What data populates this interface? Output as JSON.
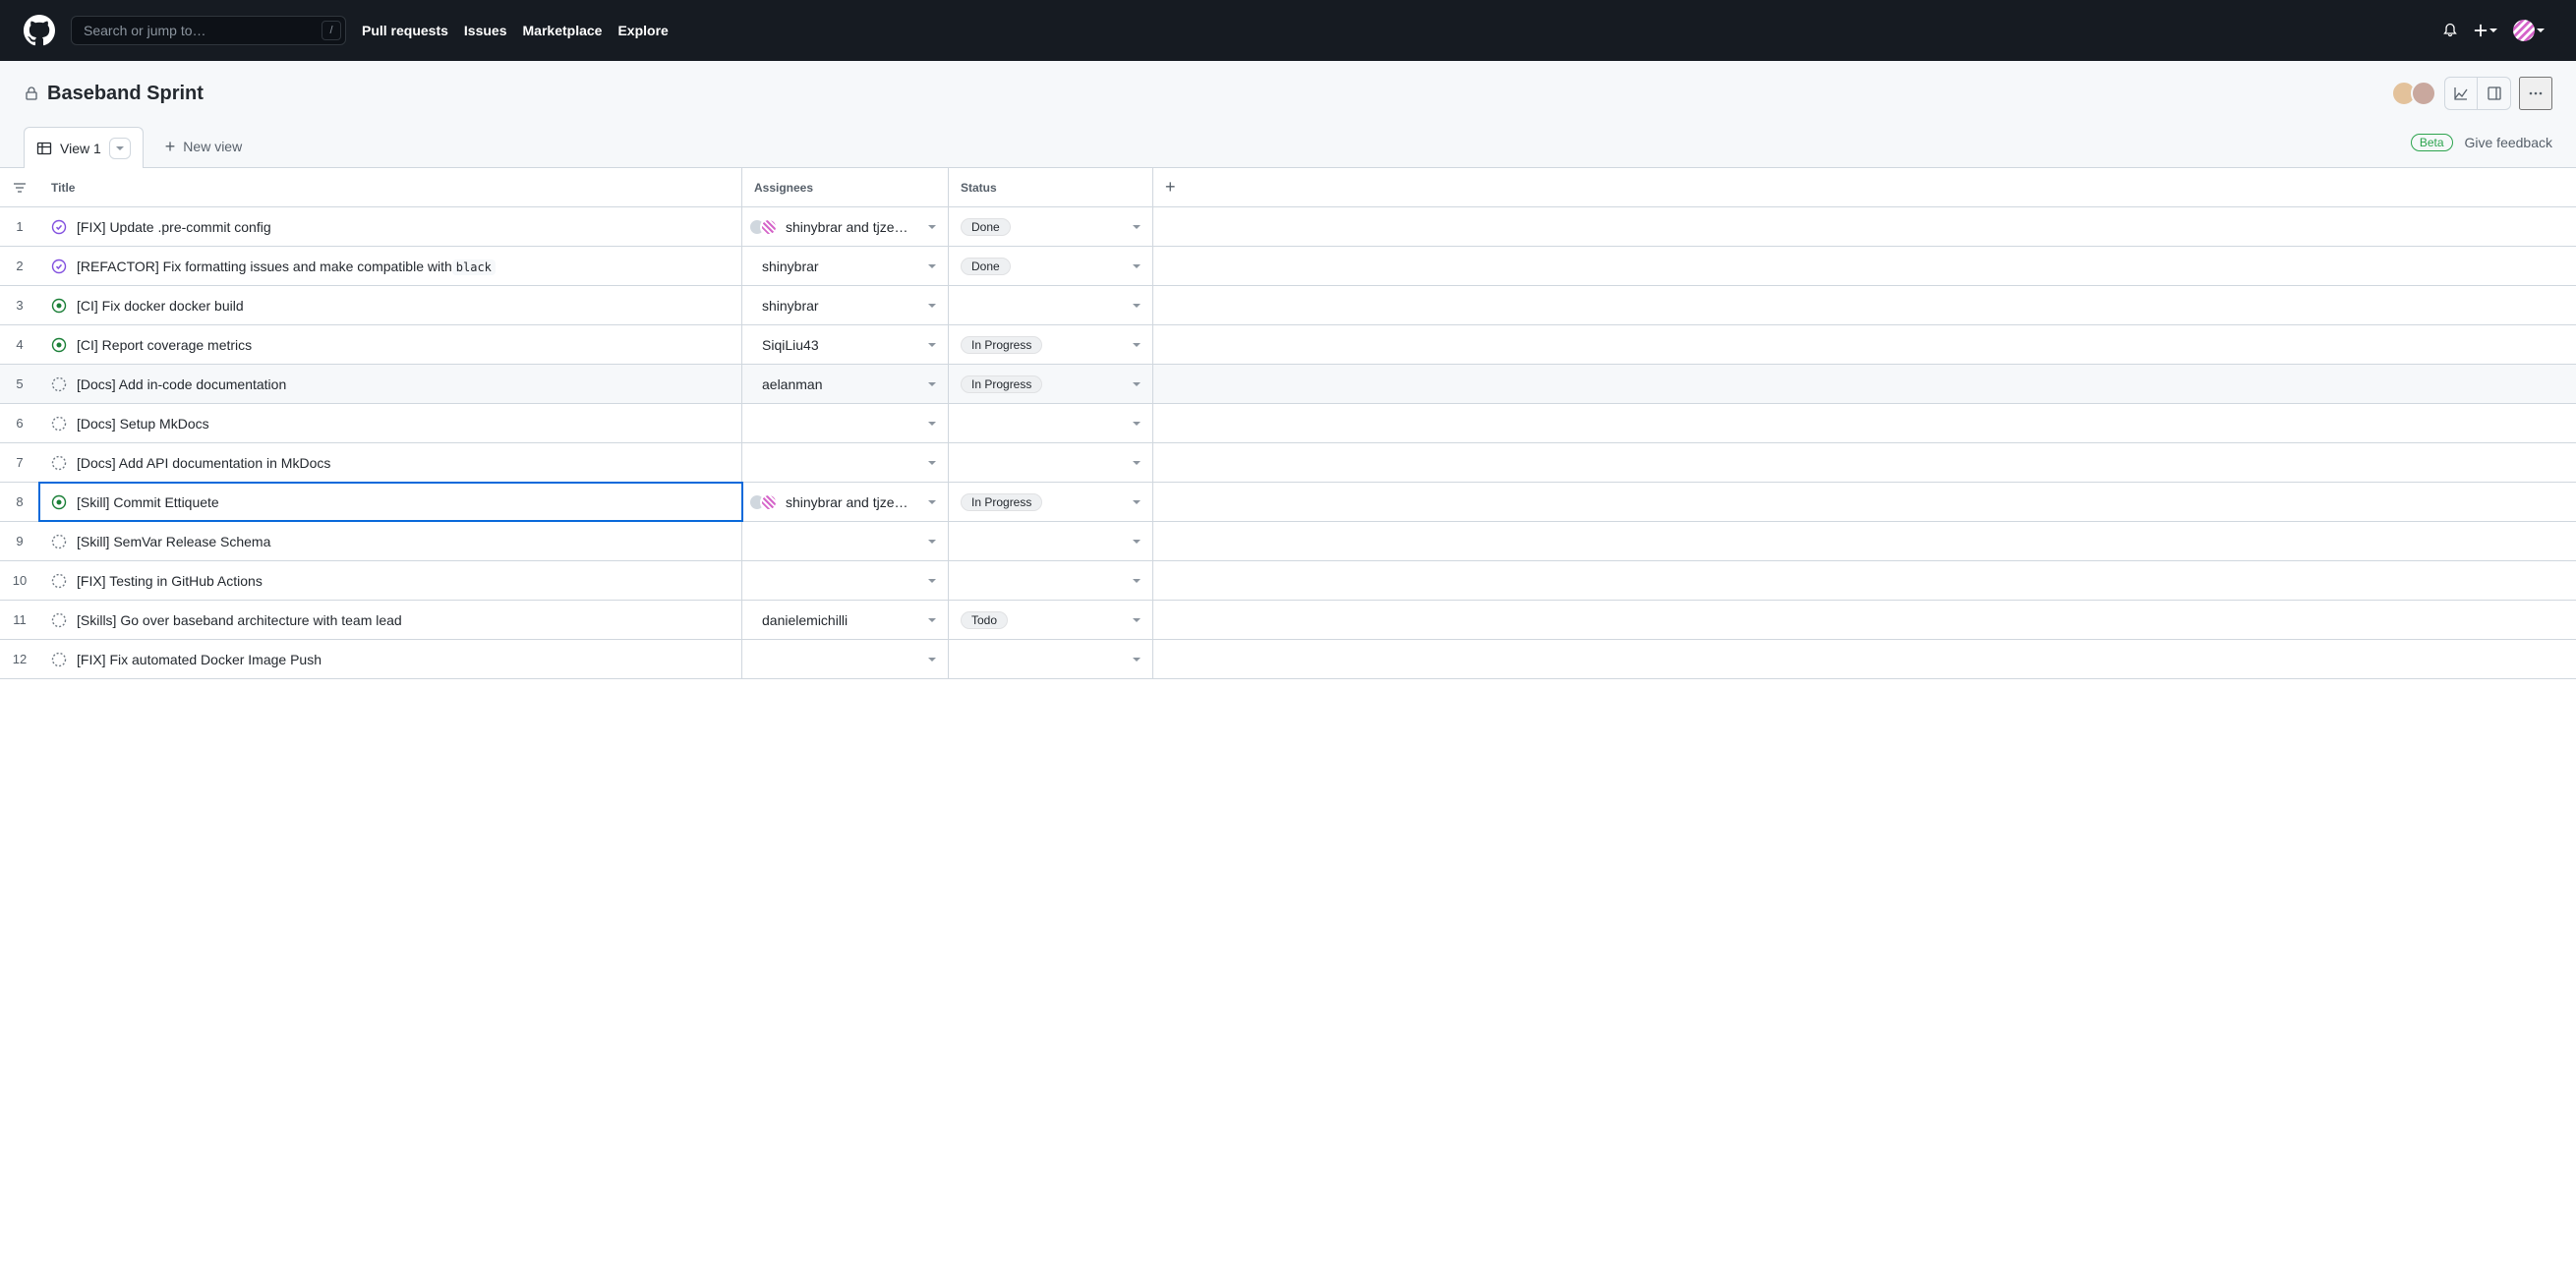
{
  "header": {
    "search_placeholder": "Search or jump to…",
    "search_kbd": "/",
    "nav": {
      "pull_requests": "Pull requests",
      "issues": "Issues",
      "marketplace": "Marketplace",
      "explore": "Explore"
    }
  },
  "project": {
    "title": "Baseband Sprint",
    "beta_label": "Beta",
    "feedback_label": "Give feedback",
    "tabs": {
      "view1_label": "View 1",
      "new_view_label": "New view"
    }
  },
  "columns": {
    "title": "Title",
    "assignees": "Assignees",
    "status": "Status"
  },
  "statuses": {
    "done": "Done",
    "in_progress": "In Progress",
    "todo": "Todo"
  },
  "rows": [
    {
      "num": "1",
      "state": "closed",
      "title": "[FIX] Update .pre-commit config",
      "assignees_text": "shinybrar and tjze…",
      "assignees_avatars": [
        "gray",
        "pink"
      ],
      "status": "done"
    },
    {
      "num": "2",
      "state": "closed",
      "title_prefix": "[REFACTOR] Fix formatting issues and make compatible with",
      "code": "black",
      "assignees_text": "shinybrar",
      "assignees_avatars": [
        "gray"
      ],
      "status": "done"
    },
    {
      "num": "3",
      "state": "open",
      "title": "[CI] Fix docker docker build",
      "assignees_text": "shinybrar",
      "assignees_avatars": [
        "gray"
      ],
      "status": ""
    },
    {
      "num": "4",
      "state": "open",
      "title": "[CI] Report coverage metrics",
      "assignees_text": "SiqiLiu43",
      "assignees_avatars": [
        "dog"
      ],
      "status": "in_progress"
    },
    {
      "num": "5",
      "state": "draft",
      "title": "[Docs] Add in-code documentation",
      "assignees_text": "aelanman",
      "assignees_avatars": [
        "purple"
      ],
      "status": "in_progress",
      "hovered": true
    },
    {
      "num": "6",
      "state": "draft",
      "title": "[Docs] Setup MkDocs",
      "assignees_text": "",
      "assignees_avatars": [],
      "status": ""
    },
    {
      "num": "7",
      "state": "draft",
      "title": "[Docs] Add API documentation in MkDocs",
      "assignees_text": "",
      "assignees_avatars": [],
      "status": ""
    },
    {
      "num": "8",
      "state": "open",
      "title": "[Skill] Commit Ettiquete",
      "assignees_text": "shinybrar and tjze…",
      "assignees_avatars": [
        "gray",
        "pink"
      ],
      "status": "in_progress",
      "selected": true
    },
    {
      "num": "9",
      "state": "draft",
      "title": "[Skill] SemVar Release Schema",
      "assignees_text": "",
      "assignees_avatars": [],
      "status": ""
    },
    {
      "num": "10",
      "state": "draft",
      "title": "[FIX] Testing in GitHub Actions",
      "assignees_text": "",
      "assignees_avatars": [],
      "status": ""
    },
    {
      "num": "11",
      "state": "draft",
      "title": "[Skills] Go over baseband architecture with team lead",
      "assignees_text": "danielemichilli",
      "assignees_avatars": [
        "purple"
      ],
      "status": "todo"
    },
    {
      "num": "12",
      "state": "draft",
      "title": "[FIX] Fix automated Docker Image Push",
      "assignees_text": "",
      "assignees_avatars": [],
      "status": ""
    }
  ]
}
